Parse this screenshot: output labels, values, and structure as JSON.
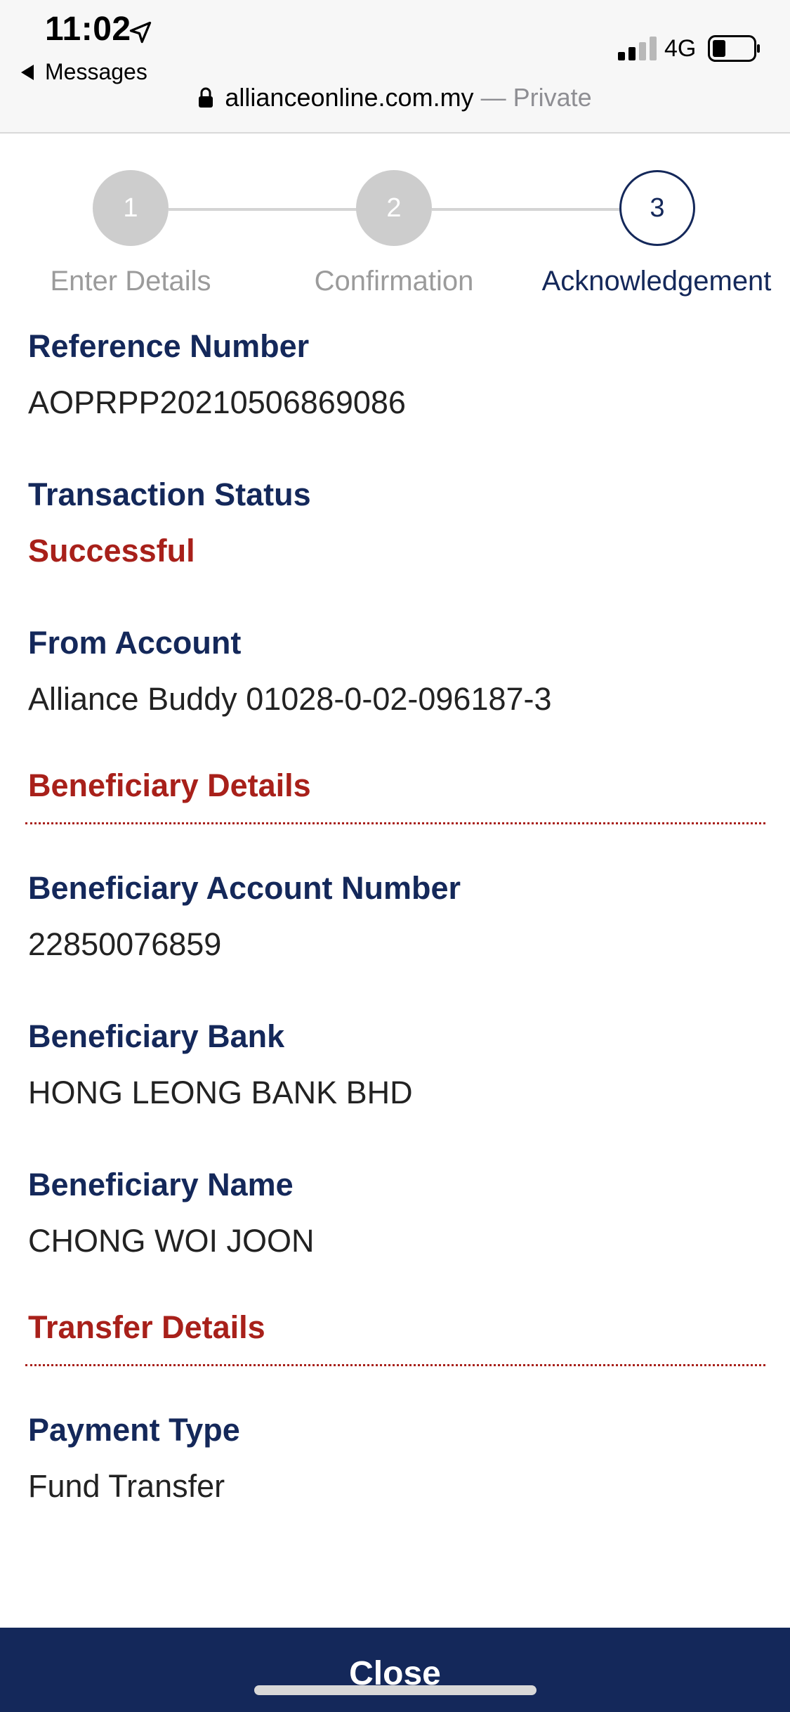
{
  "status_bar": {
    "time": "11:02",
    "back_app": "Messages",
    "network": "4G"
  },
  "browser": {
    "domain": "allianceonline.com.my",
    "private_label": "— Private"
  },
  "stepper": {
    "steps": [
      {
        "number": "1",
        "label": "Enter Details",
        "state": "completed"
      },
      {
        "number": "2",
        "label": "Confirmation",
        "state": "completed"
      },
      {
        "number": "3",
        "label": "Acknowledgement",
        "state": "current"
      }
    ]
  },
  "transaction": {
    "reference_label": "Reference Number",
    "reference_value": "AOPRPP20210506869086",
    "status_label": "Transaction Status",
    "status_value": "Successful",
    "from_label": "From Account",
    "from_value": "Alliance Buddy 01028-0-02-096187-3"
  },
  "beneficiary": {
    "section_title": "Beneficiary Details",
    "account_label": "Beneficiary Account Number",
    "account_value": "22850076859",
    "bank_label": "Beneficiary Bank",
    "bank_value": "HONG LEONG BANK BHD",
    "name_label": "Beneficiary Name",
    "name_value": "CHONG WOI JOON"
  },
  "transfer": {
    "section_title": "Transfer Details",
    "payment_type_label": "Payment Type",
    "payment_type_value": "Fund Transfer"
  },
  "footer": {
    "close_label": "Close"
  },
  "colors": {
    "navy": "#14285a",
    "accent_red": "#a8201a",
    "inactive_step": "#cdcdcd"
  },
  "icons": [
    "location-arrow-icon",
    "back-triangle-icon",
    "signal-icon",
    "battery-icon",
    "lock-icon"
  ]
}
